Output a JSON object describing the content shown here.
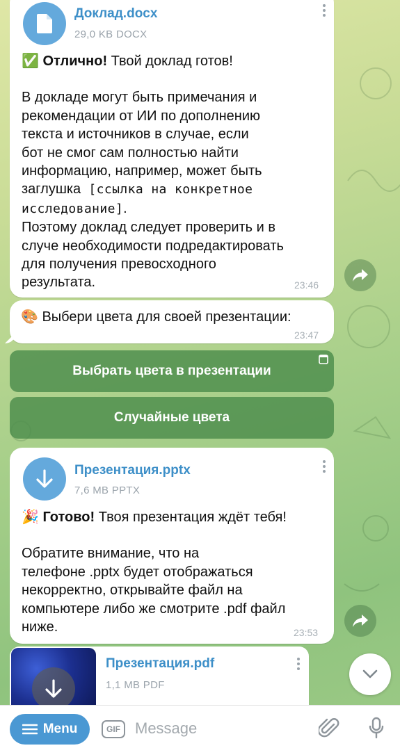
{
  "messages": {
    "doc_file": {
      "name": "Доклад.docx",
      "meta": "29,0 KB DOCX"
    },
    "doc_text": {
      "emoji": "✅",
      "bold": "Отлично!",
      "rest": " Твой доклад готов!",
      "para2_lines": [
        "В докладе могут быть примечания и",
        "рекомендации от ИИ по дополнению",
        "текста и источников в случае, если",
        "бот не смог сам полностью найти",
        "информацию, например, может быть"
      ],
      "para2_mono_prefix": "заглушка",
      "para2_mono_line1": " [ссылка на конкретное",
      "para2_mono_line2": "исследование]",
      "para2_mono_suffix": ".",
      "para3_lines": [
        "Поэтому доклад следует проверить и в",
        "случе необходимости подредактировать",
        "для получения превосходного",
        "результата."
      ],
      "time": "23:46"
    },
    "colors_prompt": {
      "emoji": "🎨",
      "text": "Выбери цвета для своей презентации:",
      "time": "23:47"
    },
    "inline_buttons": [
      {
        "label": "Выбрать цвета в презентации"
      },
      {
        "label": "Случайные цвета"
      }
    ],
    "pptx_file": {
      "name": "Презентация.pptx",
      "meta": "7,6 MB PPTX"
    },
    "pptx_text": {
      "emoji": "🎉",
      "bold": "Готово!",
      "rest": " Твоя презентация ждёт тебя!",
      "para2_lines": [
        "Обратите внимание, что на",
        "телефоне .pptx будет отображаться",
        "некорректно, открывайте файл на",
        "компьютере либо же смотрите .pdf файл",
        "ниже."
      ],
      "time": "23:53"
    },
    "pdf_file": {
      "name": "Презентация.pdf",
      "meta": "1,1 MB PDF"
    }
  },
  "input_bar": {
    "menu_label": "Menu",
    "gif_label": "GIF",
    "placeholder": "Message"
  },
  "colors": {
    "accent": "#4a98d3",
    "file_icon": "#64a9dc",
    "inline_button": "#4c8c4c"
  }
}
